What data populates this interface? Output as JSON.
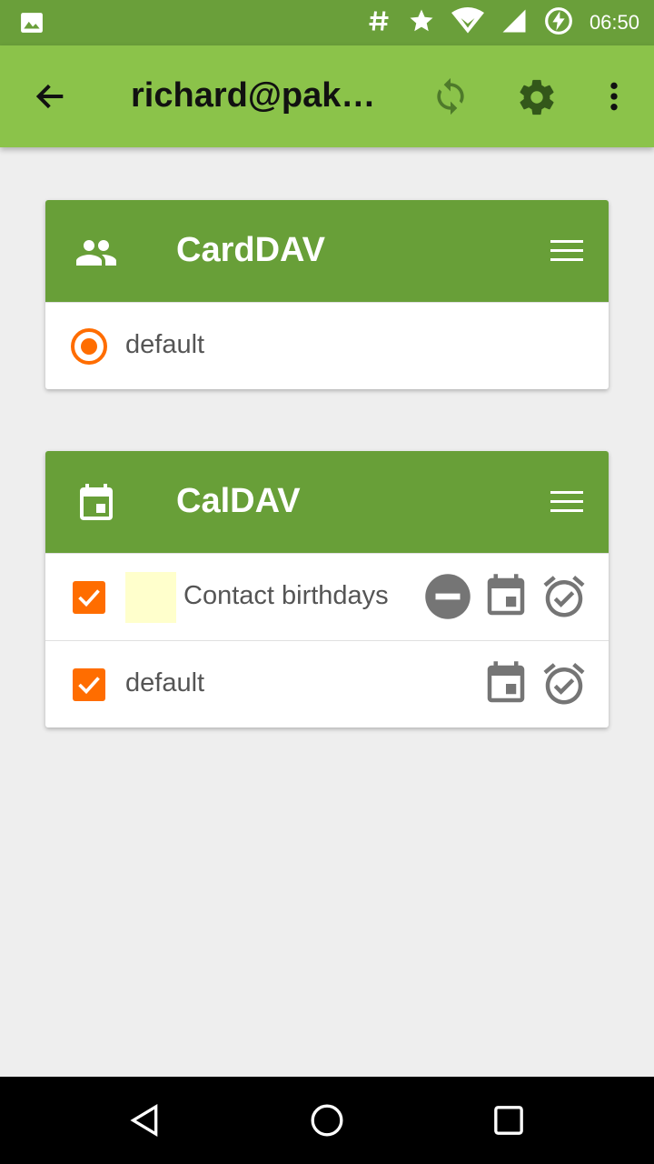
{
  "status_bar": {
    "time": "06:50",
    "icons": [
      "image-icon",
      "hash-icon",
      "star-icon",
      "wifi-icon",
      "signal-icon",
      "battery-charging-icon"
    ]
  },
  "app_bar": {
    "title": "richard@pakk…",
    "icons": [
      "back-arrow-icon",
      "sync-icon",
      "settings-gear-icon",
      "more-vert-icon"
    ]
  },
  "carddav": {
    "title": "CardDAV",
    "header_icon": "contacts-icon",
    "menu_icon": "menu-icon",
    "items": [
      {
        "label": "default",
        "selected": true
      }
    ]
  },
  "caldav": {
    "title": "CalDAV",
    "header_icon": "calendar-icon",
    "menu_icon": "menu-icon",
    "items": [
      {
        "label": "Contact birthdays",
        "checked": true,
        "color": "#ffffcc",
        "read_only": true
      },
      {
        "label": "default",
        "checked": true
      }
    ]
  },
  "colors": {
    "status_bar": "#6a9f3a",
    "app_bar": "#8bc34a",
    "card_header": "#689f38",
    "accent": "#ff6d00",
    "icon_gray": "#757575"
  },
  "nav_bar": {
    "icons": [
      "back-nav-icon",
      "home-nav-icon",
      "recents-nav-icon"
    ]
  }
}
